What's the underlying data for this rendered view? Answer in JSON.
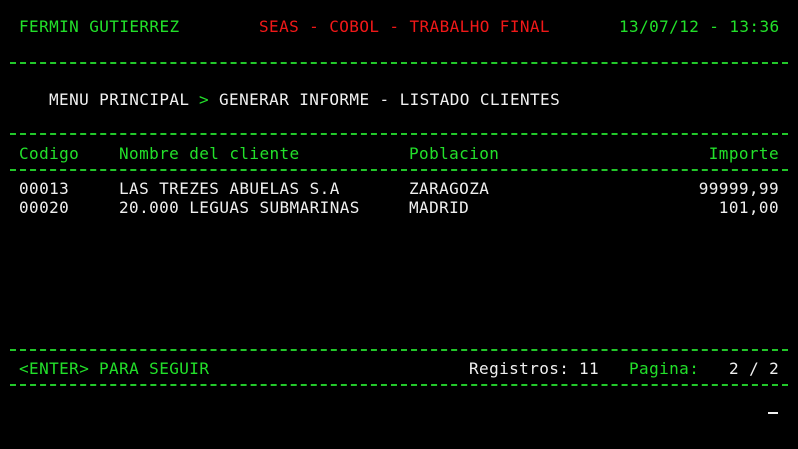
{
  "header": {
    "user_name": "FERMIN GUTIERREZ",
    "app_title": "SEAS - COBOL - TRABALHO FINAL",
    "datetime": "13/07/12 - 13:36"
  },
  "breadcrumb": {
    "menu": "MENU PRINCIPAL",
    "separator": ">",
    "path": "GENERAR INFORME - LISTADO CLIENTES"
  },
  "table": {
    "headers": {
      "code": "Codigo",
      "name": "Nombre del cliente",
      "city": "Poblacion",
      "amount": "Importe"
    },
    "rows": [
      {
        "code": "00013",
        "name": "LAS TREZES ABUELAS S.A",
        "city": "ZARAGOZA",
        "amount": "99999,99"
      },
      {
        "code": "00020",
        "name": "20.000 LEGUAS SUBMARINAS",
        "city": "MADRID",
        "amount": "101,00"
      }
    ]
  },
  "footer": {
    "enter_key": "<ENTER>",
    "continue_label": "PARA SEGUIR",
    "records_label": "Registros:",
    "records_value": "11",
    "page_label": "Pagina:",
    "page_value": "2 / 2"
  },
  "colors": {
    "background": "#000000",
    "green": "#22e02a",
    "red": "#f01818",
    "white": "#f0f0f0"
  }
}
